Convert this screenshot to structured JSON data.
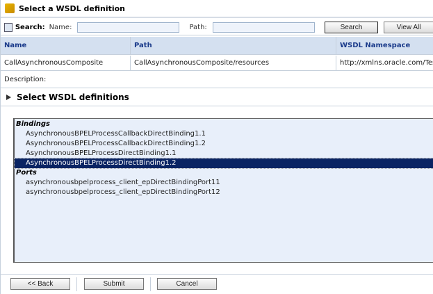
{
  "title": "Select a WSDL definition",
  "search": {
    "label": "Search:",
    "name_label": "Name:",
    "name_value": "",
    "path_label": "Path:",
    "path_value": "",
    "search_button": "Search",
    "view_all_button": "View All"
  },
  "table": {
    "columns": [
      "Name",
      "Path",
      "WSDL Namespace"
    ],
    "rows": [
      [
        "CallAsynchronousComposite",
        "CallAsynchronousComposite/resources",
        "http://xmlns.oracle.com/Test"
      ]
    ]
  },
  "description_label": "Description:",
  "section_title": "Select WSDL definitions",
  "list": {
    "bindings_label": "Bindings",
    "bindings": [
      "AsynchronousBPELProcessCallbackDirectBinding1.1",
      "AsynchronousBPELProcessCallbackDirectBinding1.2",
      "AsynchronousBPELProcessDirectBinding1.1",
      "AsynchronousBPELProcessDirectBinding1.2"
    ],
    "selected": "AsynchronousBPELProcessDirectBinding1.2",
    "ports_label": "Ports",
    "ports": [
      "asynchronousbpelprocess_client_epDirectBindingPort11",
      "asynchronousbpelprocess_client_epDirectBindingPort12"
    ]
  },
  "footer": {
    "back": "<< Back",
    "submit": "Submit",
    "cancel": "Cancel"
  },
  "colors": {
    "header_bg": "#d4e0f0",
    "header_text": "#1a3a8a",
    "selection": "#0a2463",
    "list_bg": "#e8effa"
  }
}
